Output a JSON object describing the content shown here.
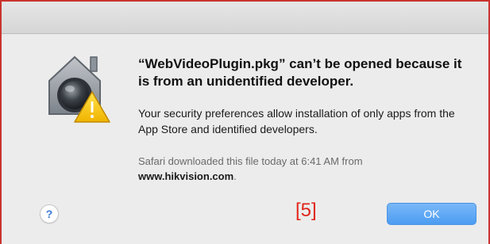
{
  "dialog": {
    "icon": "gatekeeper-warning-icon",
    "title": "“WebVideoPlugin.pkg” can’t be opened because it is from an unidentified developer.",
    "message": "Your security preferences allow installation of only apps from the App Store and identified developers.",
    "source_text": "Safari downloaded this file today at 6:41 AM from",
    "source_url": "www.hikvision.com",
    "source_suffix": ".",
    "help_label": "?",
    "ok_label": "OK"
  },
  "annotation": {
    "label": "[5]"
  },
  "colors": {
    "accent": "#4c9cf2",
    "annotation": "#e0241b",
    "warning": "#f5c400"
  }
}
